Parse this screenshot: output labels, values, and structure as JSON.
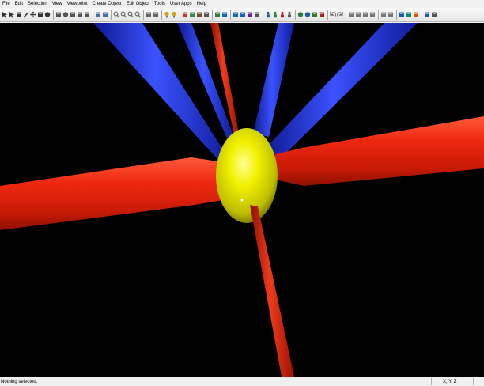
{
  "menu": [
    "File",
    "Edit",
    "Selection",
    "View",
    "Viewpoint",
    "Create Object",
    "Edit Object",
    "Tools",
    "User Apps",
    "Help"
  ],
  "toolbar": {
    "tools": [
      {
        "icon": "select-arrow-icon",
        "color": "#333333"
      },
      {
        "icon": "select-arrow-add-icon",
        "color": "#333333"
      },
      {
        "icon": "select-box-icon",
        "color": "#333333"
      },
      {
        "icon": "pencil-icon",
        "color": "#333333"
      },
      {
        "icon": "move-icon",
        "color": "#333333"
      },
      {
        "icon": "rotate-view-icon",
        "color": "#333333"
      },
      {
        "icon": "orbit-icon",
        "color": "#333333"
      },
      {
        "icon": "sep"
      },
      {
        "icon": "box-primitive-icon",
        "color": "#555555"
      },
      {
        "icon": "sphere-primitive-icon",
        "color": "#555555"
      },
      {
        "icon": "cylinder-primitive-icon",
        "color": "#555555"
      },
      {
        "icon": "clock-icon",
        "color": "#555555"
      },
      {
        "icon": "hand-icon",
        "color": "#555555"
      },
      {
        "icon": "sep"
      },
      {
        "icon": "link-icon",
        "color": "#4a6ea8"
      },
      {
        "icon": "unlink-icon",
        "color": "#4a6ea8"
      },
      {
        "icon": "sep"
      },
      {
        "icon": "zoom-in-icon",
        "color": "#666666"
      },
      {
        "icon": "zoom-out-icon",
        "color": "#666666"
      },
      {
        "icon": "zoom-fit-icon",
        "color": "#666666"
      },
      {
        "icon": "zoom-selected-icon",
        "color": "#666666"
      },
      {
        "icon": "sep"
      },
      {
        "icon": "camera-icon",
        "color": "#666666"
      },
      {
        "icon": "camera-target-icon",
        "color": "#666666"
      },
      {
        "icon": "sep"
      },
      {
        "icon": "light-bulb-icon",
        "color": "#d4a017"
      },
      {
        "icon": "spotlight-icon",
        "color": "#d4a017"
      },
      {
        "icon": "sep"
      },
      {
        "icon": "material-red-icon",
        "color": "#c0392b"
      },
      {
        "icon": "material-green-icon",
        "color": "#2e8b57"
      },
      {
        "icon": "paint-bucket-icon",
        "color": "#7a4b2a"
      },
      {
        "icon": "eyedropper-icon",
        "color": "#555555"
      },
      {
        "icon": "sep"
      },
      {
        "icon": "texture-icon",
        "color": "#2e7d32"
      },
      {
        "icon": "texture-map-icon",
        "color": "#1565c0"
      },
      {
        "icon": "sep"
      },
      {
        "icon": "group-icon",
        "color": "#1565c0"
      },
      {
        "icon": "ungroup-icon",
        "color": "#1565c0"
      },
      {
        "icon": "hierarchy-icon",
        "color": "#6a1b9a"
      },
      {
        "icon": "properties-icon",
        "color": "#555555"
      },
      {
        "icon": "sep"
      },
      {
        "icon": "person-blue-icon",
        "color": "#1e5aa8"
      },
      {
        "icon": "person-green-icon",
        "color": "#2e7d32"
      },
      {
        "icon": "person-red-icon",
        "color": "#b71c1c"
      },
      {
        "icon": "person-gray-icon",
        "color": "#555555"
      },
      {
        "icon": "sep"
      },
      {
        "icon": "globe-green-icon",
        "color": "#2e7d32"
      },
      {
        "icon": "globe-blue-icon",
        "color": "#1e5aa8"
      },
      {
        "icon": "tree-icon",
        "color": "#2e7d32"
      },
      {
        "icon": "flag-icon",
        "color": "#b71c1c"
      },
      {
        "icon": "sep"
      },
      {
        "icon": "undo-icon",
        "color": "#555555"
      },
      {
        "icon": "redo-icon",
        "color": "#555555"
      },
      {
        "icon": "sep"
      },
      {
        "icon": "cut-icon",
        "color": "#777777"
      },
      {
        "icon": "copy-icon",
        "color": "#777777"
      },
      {
        "icon": "paste-icon",
        "color": "#777777"
      },
      {
        "icon": "delete-icon",
        "color": "#777777"
      },
      {
        "icon": "sep"
      },
      {
        "icon": "grid-icon",
        "color": "#777777"
      },
      {
        "icon": "snap-icon",
        "color": "#777777"
      },
      {
        "icon": "sep"
      },
      {
        "icon": "render-icon",
        "color": "#1e5aa8"
      },
      {
        "icon": "wireframe-icon",
        "color": "#00897b"
      },
      {
        "icon": "shaded-icon",
        "color": "#e65100"
      },
      {
        "icon": "sep"
      },
      {
        "icon": "layers-icon",
        "color": "#1e5aa8"
      },
      {
        "icon": "settings-icon",
        "color": "#555555"
      }
    ]
  },
  "status": {
    "message": "Nothing selected.",
    "coords_label": "X, Y, Z"
  },
  "scene": {
    "background": "#000000",
    "colors": {
      "sphere": "#f0f000",
      "red_rod": "#e21a0a",
      "blue_rod": "#1f34d4"
    }
  }
}
